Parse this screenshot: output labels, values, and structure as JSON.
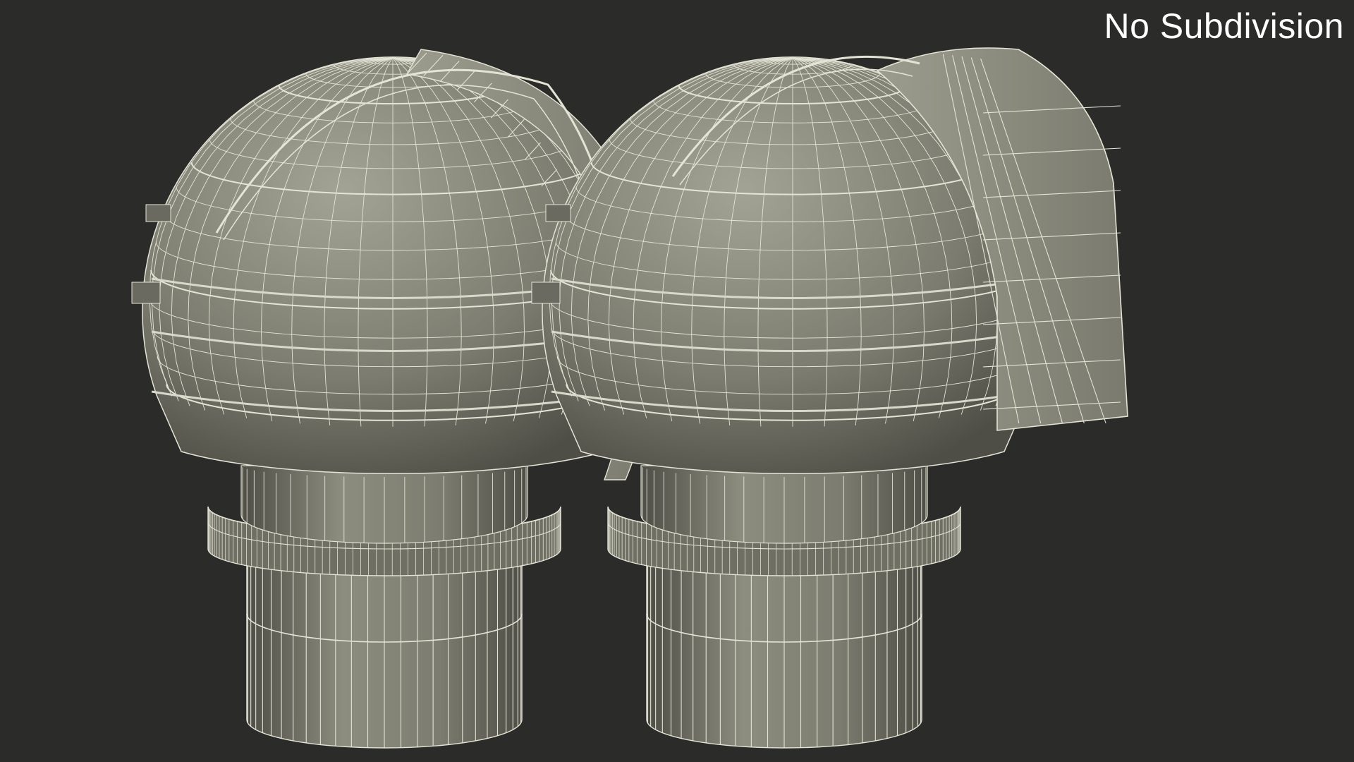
{
  "label": "No Subdivision",
  "colors": {
    "background": "#2b2b2a",
    "surface": "#7c7c70",
    "surface_light": "#a3a395",
    "surface_dark": "#4e4e46",
    "wire": "#e4e4d6"
  },
  "models": [
    {
      "name": "observatory-dome-slit-open"
    },
    {
      "name": "observatory-dome-slit-closed"
    }
  ]
}
